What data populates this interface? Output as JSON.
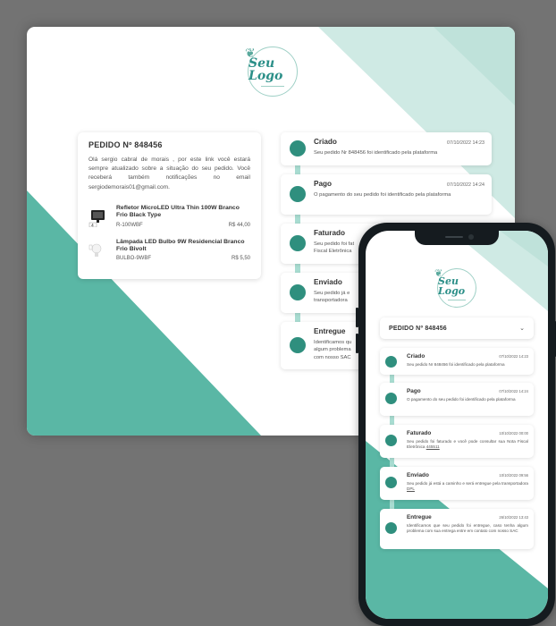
{
  "logo": {
    "text": "Seu Logo"
  },
  "order": {
    "title": "PEDIDO Nº 848456",
    "description": "Olá sergio cabral de morais , por este link você estará sempre atualizado sobre a situação do seu pedido. Você receberá também notificações no email sergiodemorais01@gmail.com.",
    "products": [
      {
        "name": "Refletor MicroLED Ultra Thin 100W Branco Frio Black Type",
        "sku": "R-100WBF",
        "price": "R$ 44,00",
        "icon": "floodlight-icon"
      },
      {
        "name": "Lâmpada LED Bulbo 9W Residencial Branco Frio Bivolt",
        "sku": "BULBO-9WBF",
        "price": "R$ 5,50",
        "icon": "lightbulb-icon"
      }
    ]
  },
  "desktop_statuses": [
    {
      "name": "Criado",
      "date": "07/10/2022 14:23",
      "desc": "Seu pedido Nr 848456 foi identificado pela plataforma"
    },
    {
      "name": "Pago",
      "date": "07/10/2022 14:24",
      "desc": "O pagamento do seu pedido foi identificado pela plataforma"
    },
    {
      "name": "Faturado",
      "desc_a": "Seu pedido foi fat",
      "desc_b": "Fiscal Eletrônica"
    },
    {
      "name": "Enviado",
      "desc_a": "Seu pedido já e",
      "desc_b": "transportadora"
    },
    {
      "name": "Entregue",
      "desc_a": "Identificamos qu",
      "desc_b": "algum problema",
      "desc_c": "com nosso SAC"
    }
  ],
  "mobile": {
    "order_title": "PEDIDO Nº 848456",
    "statuses": [
      {
        "name": "Criado",
        "date": "07/10/2022 14:23",
        "desc": "Seu pedido Nr 848456 foi identificado pela plataforma"
      },
      {
        "name": "Pago",
        "date": "07/10/2022 14:24",
        "desc": "O pagamento do seu pedido foi identificado pela plataforma"
      },
      {
        "name": "Faturado",
        "date": "10/10/2022 00:00",
        "desc": "Seu pedido foi faturado e você pode consultar sua Nota Fiscal Eletrônica ",
        "link": "445511"
      },
      {
        "name": "Enviado",
        "date": "10/10/2022 09:56",
        "desc": "Seu pedido já está a caminho e será entregue pela transportadora ",
        "link": "DPL"
      },
      {
        "name": "Entregue",
        "date": "26/10/2022 13:43",
        "desc": "Identificamos que seu pedido foi entregue, caso tenha algum problema com sua entrega entre em contato com nosso SAC"
      }
    ]
  },
  "colors": {
    "accent": "#2f8f7e",
    "teal_band": "#5ab7a5",
    "light_band": "#cfeae4",
    "timeline": "#a9ddd2"
  }
}
